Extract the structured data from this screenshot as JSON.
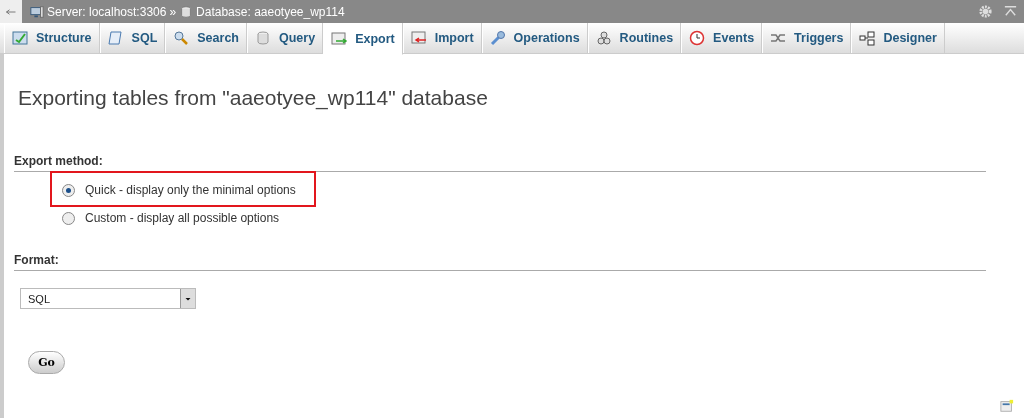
{
  "breadcrumb": [
    {
      "kind": "server",
      "label": "Server: localhost:3306"
    },
    {
      "kind": "separator",
      "label": "»"
    },
    {
      "kind": "database",
      "label": "Database: aaeotyee_wp114"
    }
  ],
  "tabs": [
    {
      "kind": "structure",
      "label": "Structure",
      "selected": false
    },
    {
      "kind": "sql",
      "label": "SQL",
      "selected": false
    },
    {
      "kind": "search",
      "label": "Search",
      "selected": false
    },
    {
      "kind": "query",
      "label": "Query",
      "selected": false
    },
    {
      "kind": "export",
      "label": "Export",
      "selected": true
    },
    {
      "kind": "import",
      "label": "Import",
      "selected": false
    },
    {
      "kind": "operations",
      "label": "Operations",
      "selected": false
    },
    {
      "kind": "routines",
      "label": "Routines",
      "selected": false
    },
    {
      "kind": "events",
      "label": "Events",
      "selected": false
    },
    {
      "kind": "triggers",
      "label": "Triggers",
      "selected": false
    },
    {
      "kind": "designer",
      "label": "Designer",
      "selected": false
    }
  ],
  "page_title": "Exporting tables from \"aaeotyee_wp114\" database",
  "export_method": {
    "heading": "Export method:",
    "options": [
      {
        "label": "Quick - display only the minimal options",
        "selected": true,
        "highlighted": true
      },
      {
        "label": "Custom - display all possible options",
        "selected": false,
        "highlighted": false
      }
    ]
  },
  "format": {
    "heading": "Format:",
    "value": "SQL"
  },
  "go_button": "Go"
}
